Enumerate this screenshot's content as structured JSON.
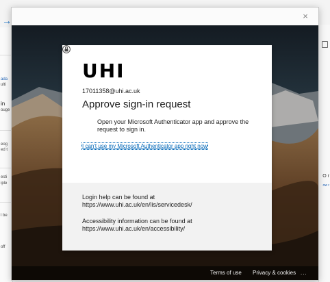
{
  "card": {
    "logo": "UHI",
    "email": "17011358@uhi.ac.uk",
    "heading": "Approve sign-in request",
    "instruction": "Open your Microsoft Authenticator app and approve the request to sign in.",
    "alt_link": "I can't use my Microsoft Authenticator app right now",
    "help": {
      "login_line1": "Login help can be found at",
      "login_line2": "https://www.uhi.ac.uk/en/lis/servicedesk/",
      "access_line1": "Accessibility information can be found at",
      "access_line2": "https://www.uhi.ac.uk/en/accessibility/"
    }
  },
  "footer": {
    "terms": "Terms of use",
    "privacy": "Privacy & cookies",
    "more": "..."
  },
  "window": {
    "close_symbol": "×"
  },
  "background": {
    "back_arrow": "→",
    "left_fragments": [
      "ada",
      "ulti",
      "in",
      "ouge",
      "eog",
      "ed t",
      "esti",
      "iple",
      "l be",
      "off"
    ],
    "right_fragments": [
      "O r",
      "ow r"
    ]
  },
  "colors": {
    "link": "#0067b8",
    "card_footer_bg": "#f2f2f2",
    "page_footer_bg": "#000000"
  },
  "icons": {
    "close": "close-icon",
    "instruction": "authenticator-lock-icon",
    "back": "arrow-icon"
  }
}
